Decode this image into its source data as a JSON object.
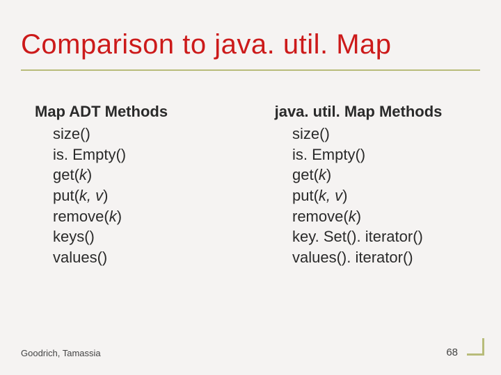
{
  "title": "Comparison to java. util. Map",
  "left": {
    "header": "Map ADT Methods",
    "methods": {
      "m0": "size()",
      "m1": "is. Empty()",
      "m2_pre": "get(",
      "m2_k": "k",
      "m2_post": ")",
      "m3_pre": "put(",
      "m3_kv": "k, v",
      "m3_post": ")",
      "m4_pre": "remove(",
      "m4_k": "k",
      "m4_post": ")",
      "m5": "keys()",
      "m6": "values()"
    }
  },
  "right": {
    "header": "java. util. Map Methods",
    "methods": {
      "m0": "size()",
      "m1": "is. Empty()",
      "m2_pre": "get(",
      "m2_k": "k",
      "m2_post": ")",
      "m3_pre": "put(",
      "m3_kv": "k, v",
      "m3_post": ")",
      "m4_pre": "remove(",
      "m4_k": "k",
      "m4_post": ")",
      "m5": "key. Set(). iterator()",
      "m6": "values(). iterator()"
    }
  },
  "footer": {
    "authors": "Goodrich, Tamassia",
    "page": "68"
  }
}
